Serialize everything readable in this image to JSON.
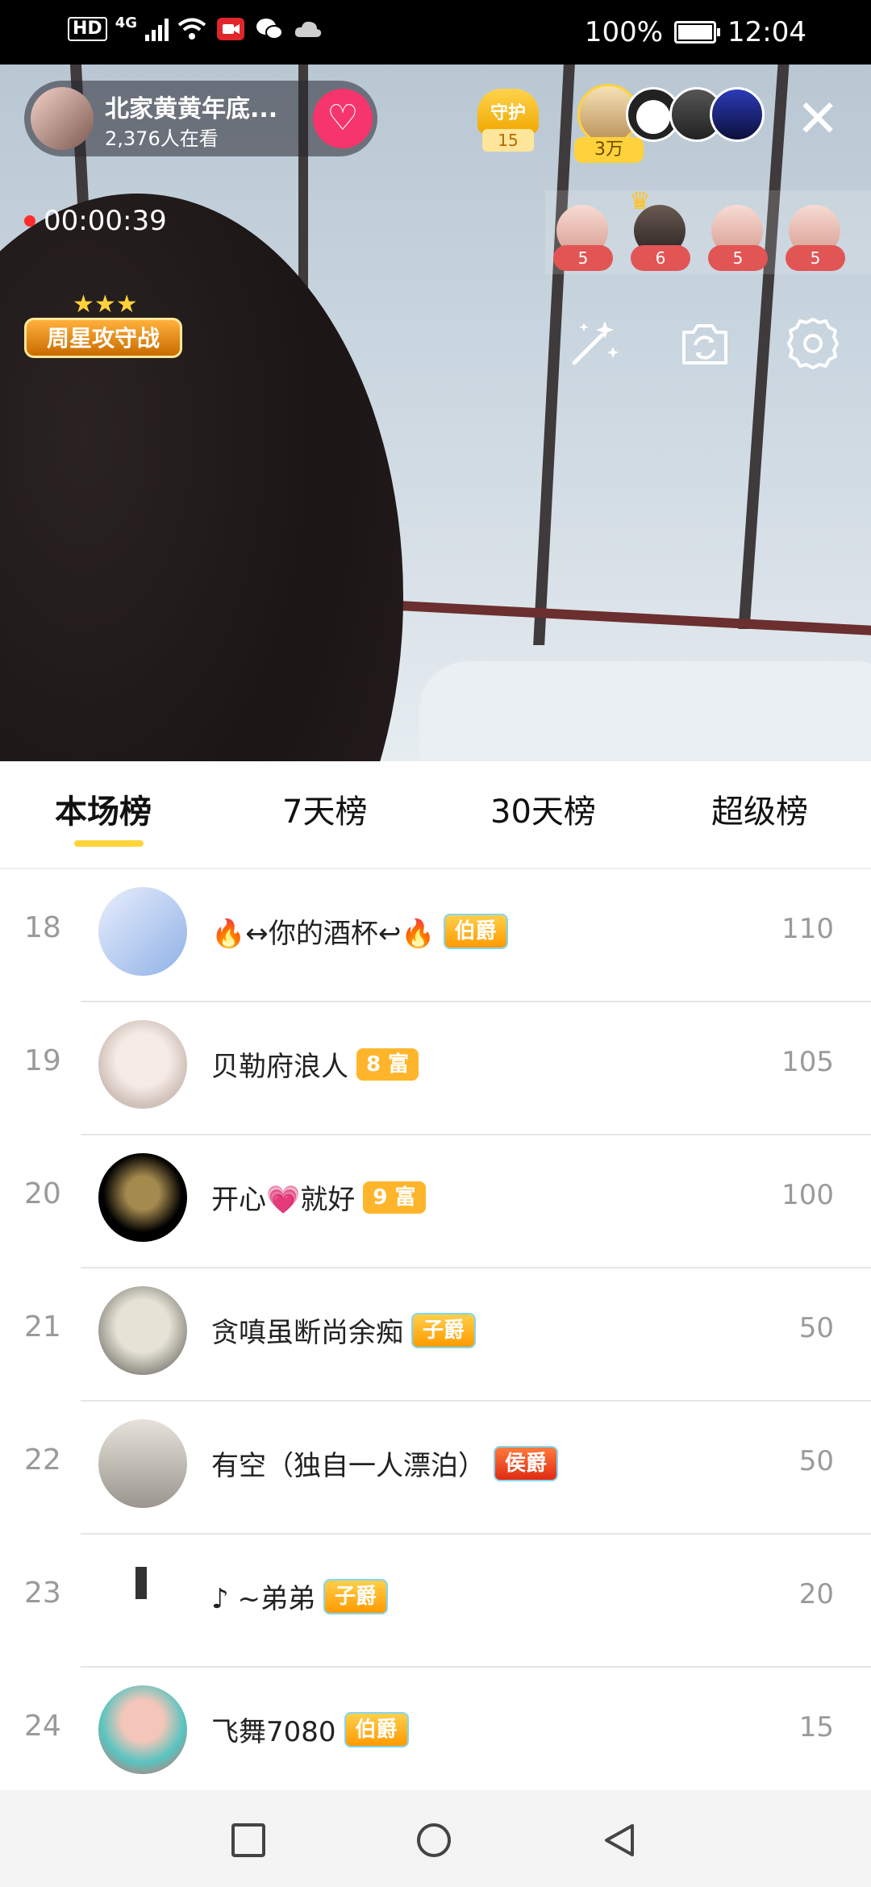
{
  "status_bar": {
    "left_indicators": [
      "HD",
      "4G"
    ],
    "battery_percent": "100%",
    "time": "12:04"
  },
  "live": {
    "host_name": "北家黄黄年底...",
    "viewers": "2,376人在看",
    "guard_label": "守护",
    "guard_count": "15",
    "top_gift_badge": "3万",
    "elapsed": "00:00:39",
    "weekly_badge": "周星攻守战",
    "fan_counts": [
      "5",
      "6",
      "5",
      "5"
    ]
  },
  "tabs": [
    {
      "label": "本场榜",
      "active": true
    },
    {
      "label": "7天榜",
      "active": false
    },
    {
      "label": "30天榜",
      "active": false
    },
    {
      "label": "超级榜",
      "active": false
    }
  ],
  "ranking": [
    {
      "rank": "18",
      "name": "🔥↔你的酒杯↩🔥",
      "badge": "伯爵",
      "badge_style": "rank",
      "score": "110",
      "avatar_color": "#c7d6f2"
    },
    {
      "rank": "19",
      "name": "贝勒府浪人",
      "badge": "8 富",
      "badge_style": "gold",
      "score": "105",
      "avatar_color": "#e9dcd6"
    },
    {
      "rank": "20",
      "name": "开心💗就好",
      "badge": "9 富",
      "badge_style": "gold",
      "score": "100",
      "avatar_color": "#2a2418"
    },
    {
      "rank": "21",
      "name": "贪嗔虽断尚余痴",
      "badge": "子爵",
      "badge_style": "rank",
      "score": "50",
      "avatar_color": "#8d8b80"
    },
    {
      "rank": "22",
      "name": "有空（独自一人漂泊）",
      "badge": "侯爵",
      "badge_style": "hou",
      "score": "50",
      "avatar_color": "#c7c2b9"
    },
    {
      "rank": "23",
      "name": "♪ ~弟弟",
      "badge": "子爵",
      "badge_style": "rank",
      "score": "20",
      "avatar_color": "#ffffff"
    },
    {
      "rank": "24",
      "name": "飞舞7080",
      "badge": "伯爵",
      "badge_style": "rank",
      "score": "15",
      "avatar_color": "#ef8f8b"
    }
  ],
  "colors": {
    "accent_yellow": "#ffd33a",
    "follow_pink": "#f5356b",
    "gold_badge": "#ffb52b",
    "rank_text": "#9a9a9a"
  }
}
